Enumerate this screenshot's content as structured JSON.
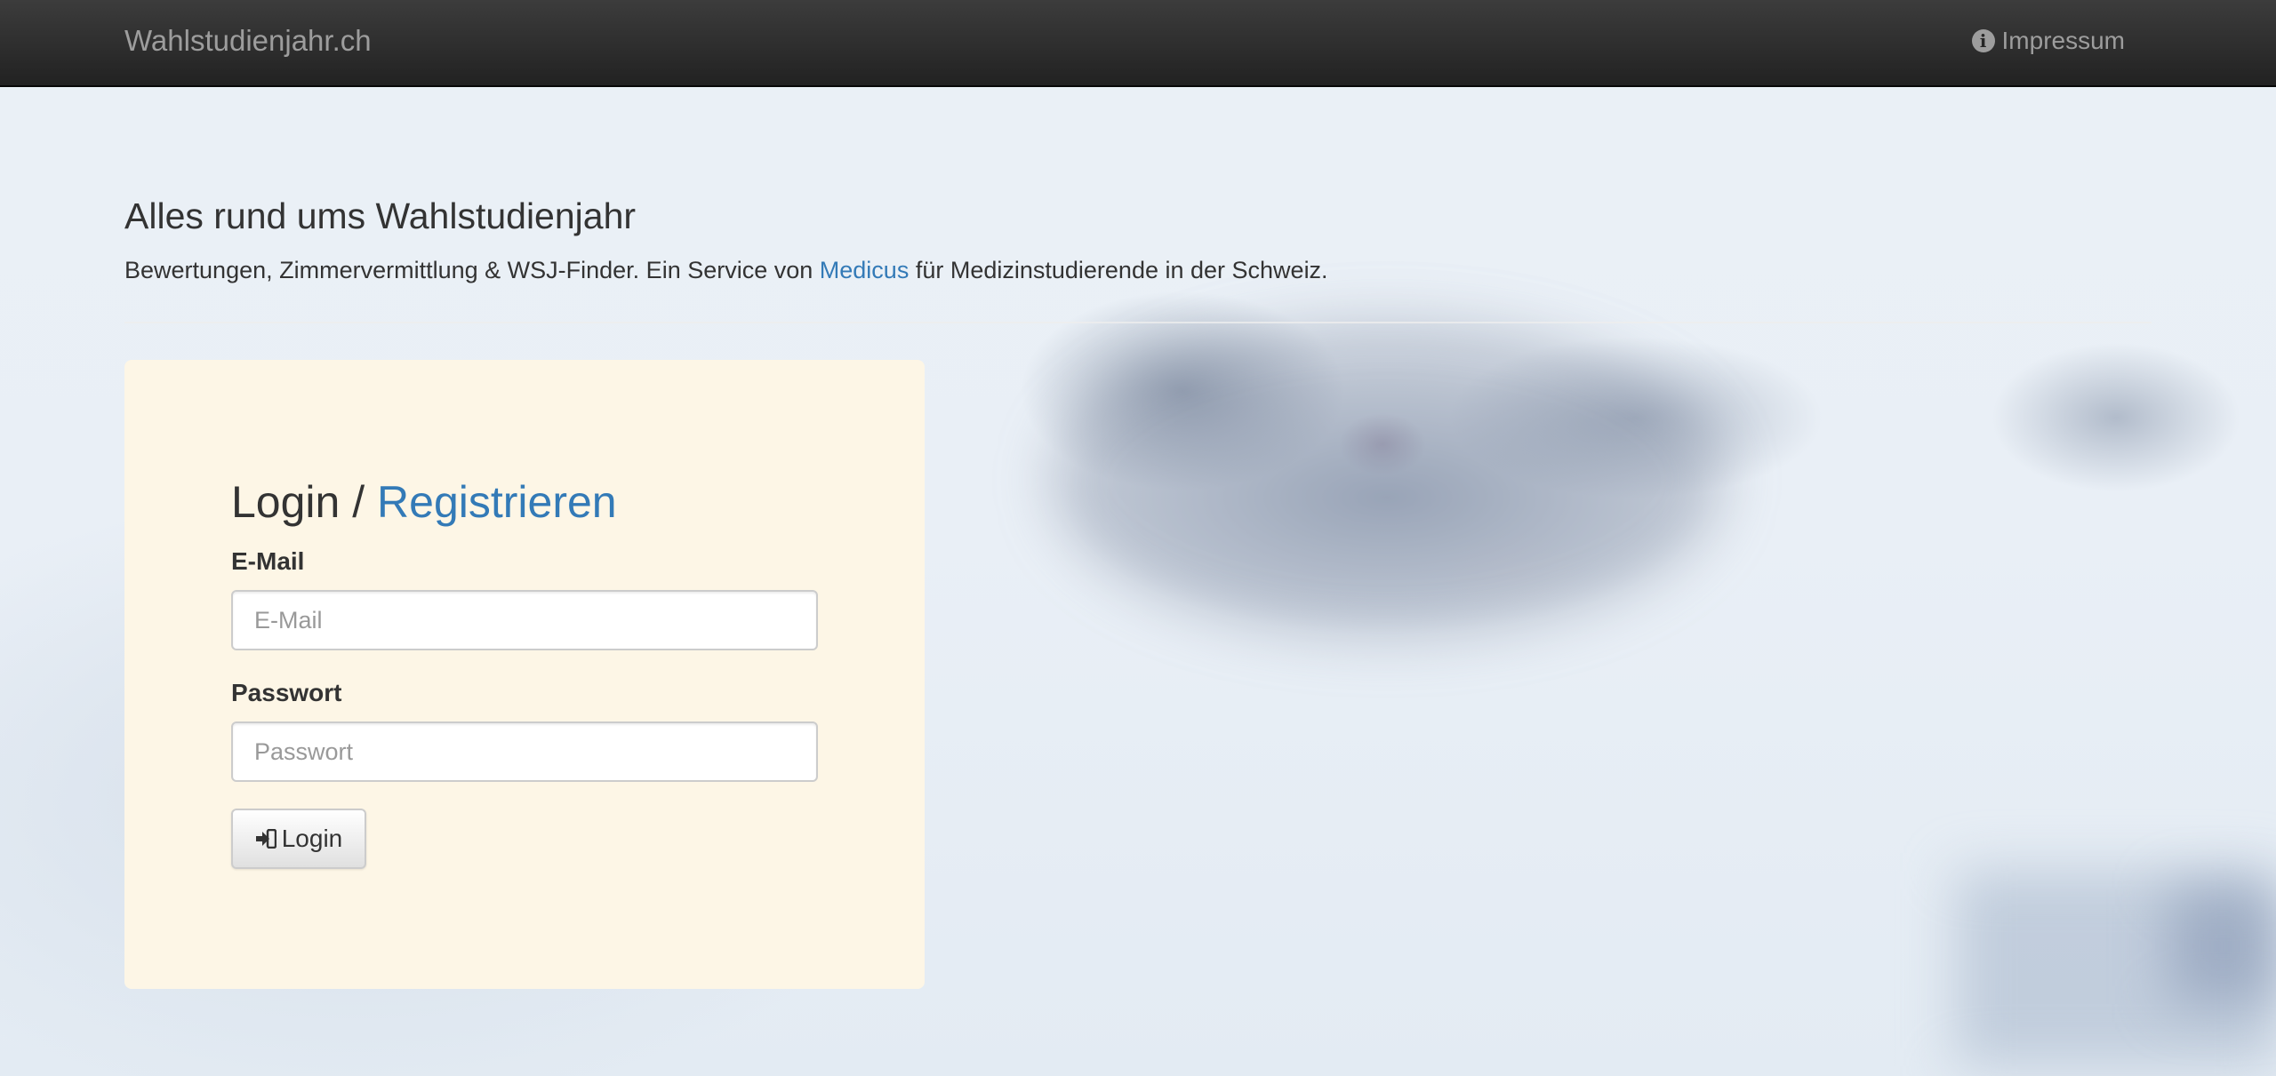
{
  "navbar": {
    "brand": "Wahlstudienjahr.ch",
    "impressum_label": "Impressum",
    "impressum_icon": "info-circle-icon"
  },
  "header": {
    "title": "Alles rund ums Wahlstudienjahr",
    "subtitle_before": "Bewertungen, Zimmervermittlung & WSJ-Finder. Ein Service von ",
    "subtitle_link": "Medicus",
    "subtitle_after": " für Medizinstudierende in der Schweiz."
  },
  "login": {
    "title_login": "Login",
    "title_separator": " / ",
    "title_register": "Registrieren",
    "email_label": "E-Mail",
    "email_placeholder": "E-Mail",
    "email_value": "",
    "password_label": "Passwort",
    "password_placeholder": "Passwort",
    "password_value": "",
    "submit_label": "Login",
    "submit_icon": "sign-in-icon"
  },
  "colors": {
    "navbar": "#222222",
    "link": "#337ab7",
    "panel": "#fdf6e6",
    "text": "#333333"
  }
}
